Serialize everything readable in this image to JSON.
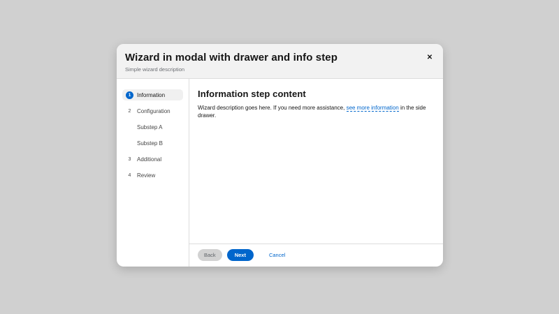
{
  "modal": {
    "title": "Wizard in modal with drawer and info step",
    "description": "Simple wizard description",
    "close_icon": "✕"
  },
  "wizard": {
    "steps": [
      {
        "number": "1",
        "label": "Information",
        "state": "current",
        "substep": false
      },
      {
        "number": "2",
        "label": "Configuration",
        "state": "pending",
        "substep": false
      },
      {
        "number": "",
        "label": "Substep A",
        "state": "pending",
        "substep": true
      },
      {
        "number": "",
        "label": "Substep B",
        "state": "pending",
        "substep": true
      },
      {
        "number": "3",
        "label": "Additional",
        "state": "pending",
        "substep": false
      },
      {
        "number": "4",
        "label": "Review",
        "state": "pending",
        "substep": false
      }
    ]
  },
  "content": {
    "heading": "Information step content",
    "body_before": "Wizard description goes here. If you need more assistance, ",
    "link_text": "see more information",
    "body_after": " in the side drawer."
  },
  "footer": {
    "back_label": "Back",
    "next_label": "Next",
    "cancel_label": "Cancel"
  },
  "colors": {
    "accent_blue": "#0066cc",
    "header_background": "#f2f2f2",
    "current_step_background": "#f0f0f0",
    "backdrop": "#d0d0d0",
    "divider": "#dcdcdc"
  }
}
